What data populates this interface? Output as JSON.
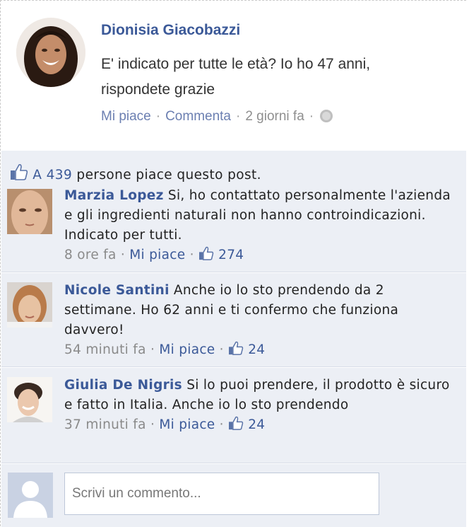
{
  "post": {
    "author": "Dionisia Giacobazzi",
    "text_line1": "E' indicato per tutte le età? Io ho 47 anni,",
    "text_line2": "rispondete grazie",
    "like_label": "Mi piace",
    "comment_label": "Commenta",
    "time": "2 giorni fa",
    "sep": "·"
  },
  "likes": {
    "prefix": "A",
    "count": "439",
    "suffix": "persone piace questo post."
  },
  "comments": [
    {
      "name": "Marzia Lopez",
      "text": "Si, ho contattato personalmente l'azienda e gli ingredienti naturali non hanno controindicazioni. Indicato per tutti.",
      "time": "8 ore fa",
      "like_label": "Mi piace",
      "likes": "274"
    },
    {
      "name": "Nicole Santini",
      "text": "Anche io lo sto prendendo da 2 settimane. Ho 62 anni e ti confermo che funziona davvero!",
      "time": "54 minuti fa",
      "like_label": "Mi piace",
      "likes": "24"
    },
    {
      "name": "Giulia De Nigris",
      "text": "Si lo puoi prendere, il prodotto è sicuro e fatto in Italia. Anche io lo sto prendendo",
      "time": "37 minuti fa",
      "like_label": "Mi piace",
      "likes": "24"
    }
  ],
  "composer": {
    "placeholder": "Scrivi un commento..."
  },
  "colors": {
    "link": "#3b5998",
    "comments_bg": "#eceff5"
  },
  "icons": [
    "globe-icon",
    "thumbs-up-icon",
    "default-avatar-icon"
  ]
}
